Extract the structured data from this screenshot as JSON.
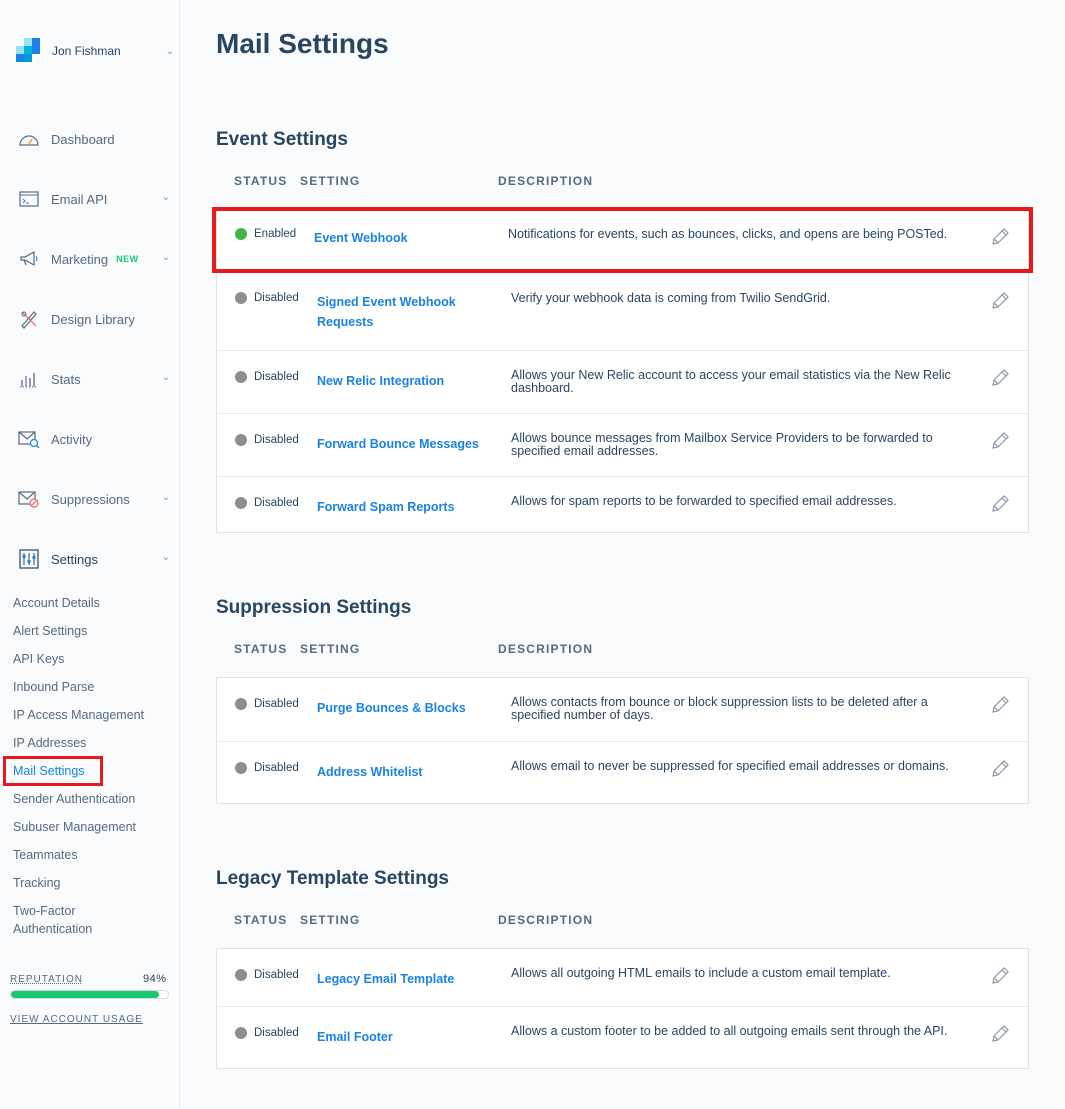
{
  "sidebar": {
    "user_name": "Jon Fishman",
    "nav": [
      {
        "label": "Dashboard",
        "icon": "dashboard-icon",
        "has_chevron": false
      },
      {
        "label": "Email API",
        "icon": "email-api-icon",
        "has_chevron": true
      },
      {
        "label": "Marketing",
        "icon": "megaphone-icon",
        "has_chevron": true,
        "badge": "NEW"
      },
      {
        "label": "Design Library",
        "icon": "design-library-icon",
        "has_chevron": false
      },
      {
        "label": "Stats",
        "icon": "stats-icon",
        "has_chevron": true
      },
      {
        "label": "Activity",
        "icon": "activity-icon",
        "has_chevron": false
      },
      {
        "label": "Suppressions",
        "icon": "suppressions-icon",
        "has_chevron": true
      },
      {
        "label": "Settings",
        "icon": "settings-icon",
        "has_chevron": true
      }
    ],
    "settings_items": [
      "Account Details",
      "Alert Settings",
      "API Keys",
      "Inbound Parse",
      "IP Access Management",
      "IP Addresses",
      "Mail Settings",
      "Sender Authentication",
      "Subuser Management",
      "Teammates",
      "Tracking",
      "Two-Factor",
      "Authentication"
    ],
    "reputation_label": "REPUTATION",
    "reputation_value": "94%",
    "reputation_fraction": 0.94,
    "usage_link": "VIEW ACCOUNT USAGE"
  },
  "main": {
    "title": "Mail Settings",
    "columns": {
      "status": "STATUS",
      "setting": "SETTING",
      "description": "DESCRIPTION"
    },
    "sections": [
      {
        "title": "Event Settings",
        "rows": [
          {
            "status": "Enabled",
            "setting": "Event Webhook",
            "description": "Notifications for events, such as bounces, clicks, and opens are being POSTed."
          },
          {
            "status": "Disabled",
            "setting": "Signed Event Webhook Requests",
            "description": "Verify your webhook data is coming from Twilio SendGrid."
          },
          {
            "status": "Disabled",
            "setting": "New Relic Integration",
            "description": "Allows your New Relic account to access your email statistics via the New Relic dashboard."
          },
          {
            "status": "Disabled",
            "setting": "Forward Bounce Messages",
            "description": "Allows bounce messages from Mailbox Service Providers to be forwarded to specified email addresses."
          },
          {
            "status": "Disabled",
            "setting": "Forward Spam Reports",
            "description": "Allows for spam reports to be forwarded to specified email addresses."
          }
        ]
      },
      {
        "title": "Suppression Settings",
        "rows": [
          {
            "status": "Disabled",
            "setting": "Purge Bounces & Blocks",
            "description": "Allows contacts from bounce or block suppression lists to be deleted after a specified number of days."
          },
          {
            "status": "Disabled",
            "setting": "Address Whitelist",
            "description": "Allows email to never be suppressed for specified email addresses or domains."
          }
        ]
      },
      {
        "title": "Legacy Template Settings",
        "rows": [
          {
            "status": "Disabled",
            "setting": "Legacy Email Template",
            "description": "Allows all outgoing HTML emails to include a custom email template."
          },
          {
            "status": "Disabled",
            "setting": "Email Footer",
            "description": "Allows a custom footer to be added to all outgoing emails sent through the API."
          }
        ]
      }
    ]
  },
  "colors": {
    "enabled": "#3fb549",
    "disabled": "#8e8e8e",
    "link": "#1a82e2",
    "highlight": "#e8191c",
    "reputation": "#18c96e"
  }
}
